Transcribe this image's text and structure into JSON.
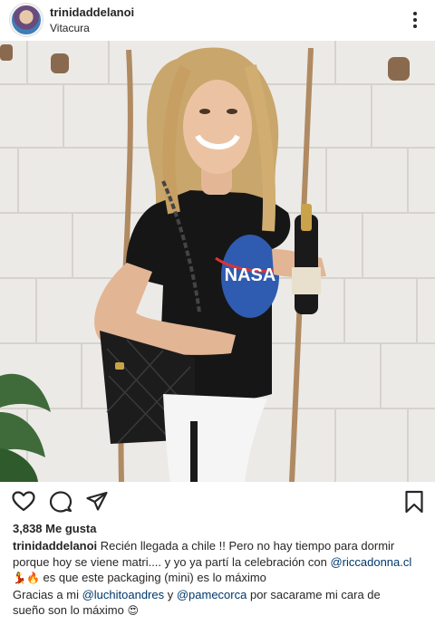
{
  "header": {
    "username": "trinidaddelanoi",
    "location": "Vitacura",
    "avatar_icon": "profile-avatar",
    "more_icon": "more-options-icon"
  },
  "post": {
    "image_alt": "woman holding champagne bottle",
    "image_logo_text": "NASA"
  },
  "actions": {
    "like_icon": "heart-icon",
    "comment_icon": "comment-icon",
    "share_icon": "share-icon",
    "save_icon": "bookmark-icon"
  },
  "likes": {
    "text": "3,838 Me gusta"
  },
  "caption": {
    "username": "trinidaddelanoi",
    "line1": "Recién llegada a chile !! Pero no hay tiempo para dormir",
    "line2a": "porque hoy se viene matri.... y yo ya partí la celebración con ",
    "mention1": "@riccadonna.cl",
    "emoji1": "💃🔥",
    "line3": " es que este packaging (mini) es lo máximo",
    "line4a": "Gracias a mi ",
    "mention2": "@luchitoandres",
    "line4b": " y ",
    "mention3": "@pamecorca",
    "line4c": " por sacarame mi cara de",
    "line5": "sueño son lo máximo ",
    "emoji2": "😍"
  },
  "colors": {
    "text": "#262626",
    "mention": "#00376b",
    "wall": "#e9e8e4"
  }
}
